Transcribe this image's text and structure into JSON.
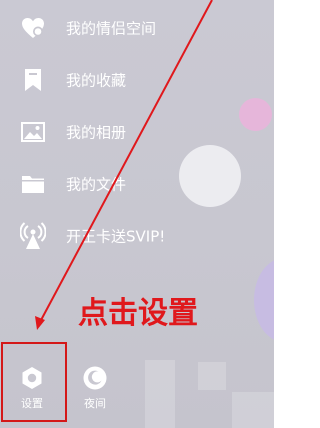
{
  "menu": {
    "items": [
      {
        "label": "我的情侣空间",
        "icon": "heart-icon"
      },
      {
        "label": "我的收藏",
        "icon": "bookmark-icon"
      },
      {
        "label": "我的相册",
        "icon": "photo-icon"
      },
      {
        "label": "我的文件",
        "icon": "folder-icon"
      },
      {
        "label": "开王卡送SVIP!",
        "icon": "signal-tower-icon"
      }
    ]
  },
  "annotation": {
    "text": "点击设置",
    "color": "#e0181c"
  },
  "bottom_bar": {
    "settings_label": "设置",
    "night_label": "夜间"
  },
  "colors": {
    "background": "#c8c7d0",
    "text": "#ffffff",
    "highlight": "#d41818"
  }
}
